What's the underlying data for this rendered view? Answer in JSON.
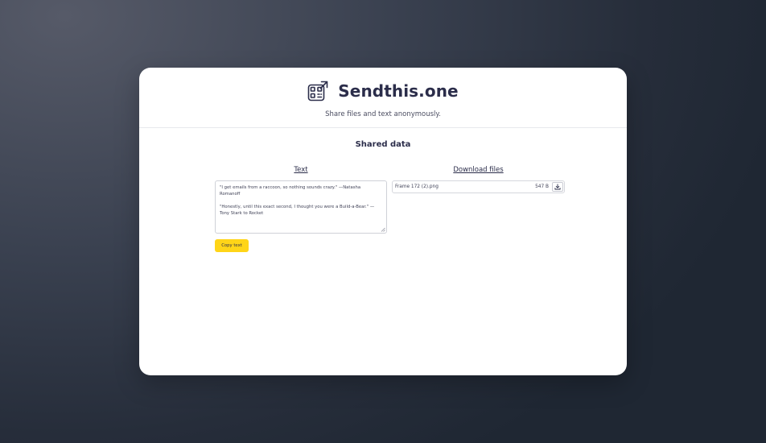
{
  "app": {
    "title": "Sendthis.one",
    "tagline": "Share files and text anonymously."
  },
  "main": {
    "section_title": "Shared data",
    "text_column": {
      "heading": "Text",
      "lines": [
        "\"I get emails from a raccoon, so nothing sounds crazy.\" —Natasha Romanoff",
        "\"Honestly, until this exact second, I thought you were a Build-a-Bear.\" — Tony Stark to Rocket"
      ],
      "copy_label": "Copy text"
    },
    "files_column": {
      "heading": "Download files",
      "files": [
        {
          "name": "Frame 172 (2).png",
          "size": "547 B"
        }
      ]
    }
  },
  "colors": {
    "accent": "#ffd518",
    "brand_text": "#2b2d4a",
    "card": "#ffffff"
  },
  "icons": {
    "logo": "qr-code-send-icon",
    "download": "download-icon",
    "resize": "resize-grip-icon"
  }
}
